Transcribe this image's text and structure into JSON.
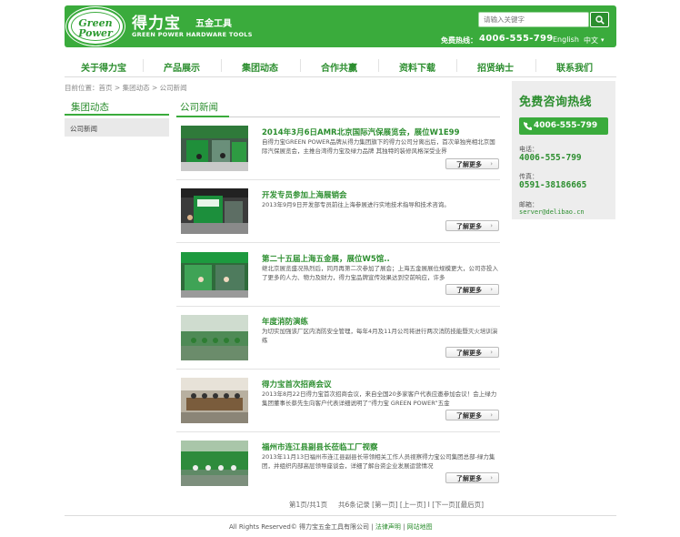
{
  "brand": {
    "logo_line1": "Green",
    "logo_line2": "Power",
    "name_cn": "得力宝",
    "name_sub": "五金工具",
    "name_en": "GREEN POWER HARDWARE TOOLS"
  },
  "header": {
    "search_placeholder": "请输入关键字",
    "hotline_label": "免费热线：",
    "hotline_number": "4006-555-799",
    "lang_en": "English",
    "lang_cn": "中文"
  },
  "nav": {
    "items": [
      "关于得力宝",
      "产品展示",
      "集团动态",
      "合作共赢",
      "资料下载",
      "招贤纳士",
      "联系我们"
    ]
  },
  "breadcrumb": {
    "prefix": "目前位置：",
    "home": "首页",
    "section": "集团动态",
    "current": "公司新闻",
    "sep": ">"
  },
  "sidebar": {
    "title": "集团动态",
    "items": [
      "公司新闻"
    ]
  },
  "main": {
    "title": "公司新闻",
    "more_label": "了解更多",
    "news": [
      {
        "title": "2014年3月6日AMR北京国际汽保展览会，展位W1E99",
        "desc": "自得力宝GREEN POWER品牌从得力集团旗下的得力公司分离出后，首次单独亮相北京国际汽保展览会，主推台湾得力宝及绿力品牌 其独特的装修风格深受业界"
      },
      {
        "title": "开发专员参加上海展销会",
        "desc": "2013年9月9日开发部专员前往上海参展进行实地技术指导和技术咨询。"
      },
      {
        "title": "第二十五届上海五金展，展位W5馆..",
        "desc": "继北京展览盛况热烈后，同月再第二次参加了展会；上海五金展展位规模更大，公司亦投入了更多的人力、物力及财力，得力宝品牌宣传效果达到空前响应，许多"
      },
      {
        "title": "年度消防演练",
        "desc": "为切实加强该厂区内消防安全管理，每年4月及11月公司将进行两次消防技能暨灭火培训演练"
      },
      {
        "title": "得力宝首次招商会议",
        "desc": "2013年8月22日得力宝首次招商会议，来自全国20多家客户代表应邀参加会议！会上绿力集团董事长蔡先生向客户代表详细说明了“得力宝 GREEN POWER”五金"
      },
      {
        "title": "福州市连江县副县长莅临工厂视察",
        "desc": "2013年11月13日福州市连江县副县长带领相关工作人员视察得力宝公司集团总部-绿力集团，并组织内部高层领导座谈会，详细了解台资企业发展运营情况"
      }
    ]
  },
  "pager": {
    "page_info": "第1页/共1页",
    "records": "共6条记录",
    "first": "[第一页]",
    "prev": "[上一页]",
    "sep": "I",
    "next": "[下一页]",
    "last": "[最后页]"
  },
  "contact": {
    "title": "免费咨询热线",
    "hotline": "4006-555-799",
    "phone_label": "电话：",
    "phone": "4006-555-799",
    "fax_label": "传真：",
    "fax": "0591-38186665",
    "email_label": "邮箱：",
    "email": "server@delibao.cn"
  },
  "footer": {
    "copyright": "All Rights Reserved© 得力宝五金工具有限公司",
    "sep": "|",
    "legal": "法律声明",
    "sitemap": "网站地图"
  },
  "colors": {
    "brand_green": "#3aab3c",
    "dark_green": "#2c8e2f",
    "sidebar_gray": "#ededed"
  }
}
